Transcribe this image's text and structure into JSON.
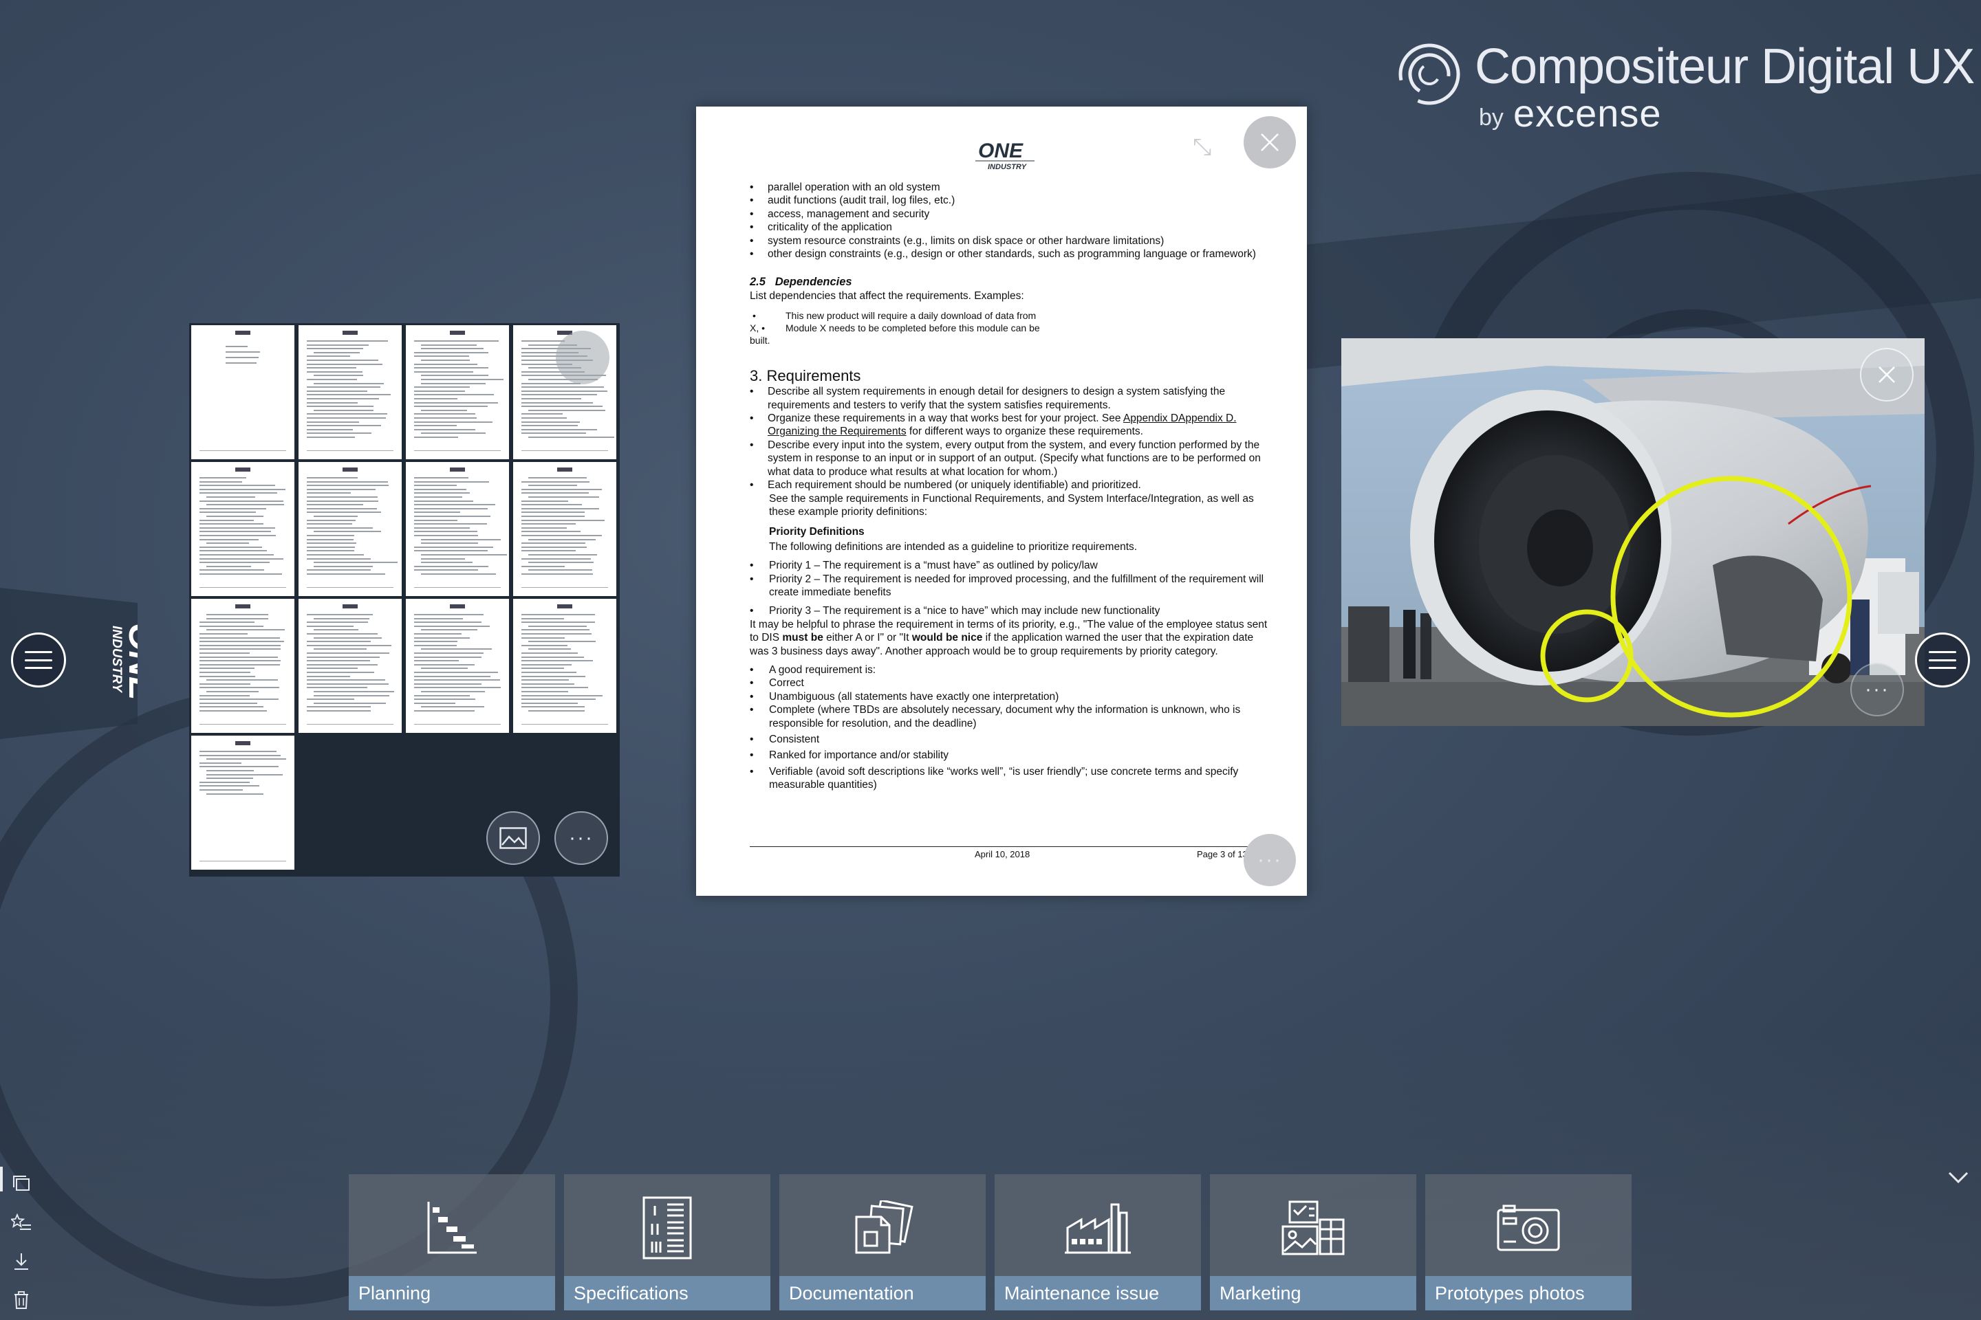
{
  "brand": {
    "title": "Compositeur Digital UX",
    "by": "by",
    "company": "excense"
  },
  "side_logo": {
    "line1": "ONE",
    "line2": "INDUSTRY"
  },
  "document": {
    "logo": {
      "line1": "ONE",
      "line2": "INDUSTRY"
    },
    "top_bullets": [
      "parallel operation with an old system",
      "audit functions (audit trail, log files, etc.)",
      "access, management and security",
      "criticality of the application",
      "system resource constraints (e.g., limits on disk space or other hardware limitations)",
      "other design constraints (e.g., design or other standards, such as programming language or framework)"
    ],
    "section_25_num": "2.5",
    "section_25_title": "Dependencies",
    "dependencies_intro": "List dependencies that affect the requirements.  Examples:",
    "dep_line1": "This new product will require a daily download of data from",
    "dep_line2_prefix": "X,  •",
    "dep_line2": "Module X needs to be completed before this module can be",
    "dep_line3": "built.",
    "section_3_title": "3. Requirements",
    "req_b1": "Describe all system requirements in enough detail for designers to design a system satisfying the requirements and testers to verify that the system satisfies requirements.",
    "req_b2_pre": "Organize these requirements in a way that works best for your project.  See ",
    "req_b2_link": "Appendix DAppendix D. Organizing the Requirements",
    "req_b2_post": "  for different ways to organize these requirements.",
    "req_b3": "Describe every input into the system, every output from the system, and every function performed by the system in response to an input or in support of an output.  (Specify what functions are to be performed on what data to produce what results at what location for whom.)",
    "req_b4": "Each requirement should be numbered (or uniquely identifiable) and prioritized.",
    "req_b4_cont": "See the sample requirements in Functional Requirements, and System Interface/Integration, as well as these example priority definitions:",
    "priority_heading": "Priority Definitions",
    "priority_intro": "The following definitions are intended as a guideline to prioritize requirements.",
    "priorities": [
      "Priority 1 – The requirement is a “must have” as outlined by policy/law",
      "Priority 2 – The requirement is needed for improved processing, and the fulfillment of the requirement will create immediate benefits",
      "Priority 3 – The requirement is a “nice to have”  which may include new functionality"
    ],
    "helpful_pre": "It may be helpful to phrase the requirement in terms of its priority, e.g., \"The value of the employee status sent to DIS ",
    "helpful_b1": "must be",
    "helpful_mid": " either A or I\" or \"It ",
    "helpful_b2": "would be nice",
    "helpful_post": " if the application warned the user that the expiration date was 3 business days away\". Another approach would be to group requirements by priority category.",
    "good_req": [
      "A good requirement is:",
      "Correct",
      "Unambiguous (all statements have exactly one interpretation)",
      "Complete (where TBDs are absolutely necessary, document why the information is unknown, who is responsible for resolution, and the deadline)",
      "Consistent",
      "Ranked for importance and/or stability",
      "Verifiable (avoid soft descriptions like “works well”, “is user friendly”; use concrete terms and specify measurable quantities)"
    ],
    "footer_date": "April 10, 2018",
    "footer_page": "Page 3 of 13"
  },
  "tiles": [
    {
      "label": "Planning",
      "icon": "gantt-chart-icon"
    },
    {
      "label": "Specifications",
      "icon": "spec-document-icon"
    },
    {
      "label": "Documentation",
      "icon": "documents-stack-icon"
    },
    {
      "label": "Maintenance issue",
      "icon": "factory-icon"
    },
    {
      "label": "Marketing",
      "icon": "marketing-board-icon"
    },
    {
      "label": "Prototypes photos",
      "icon": "camera-icon"
    }
  ],
  "left_tools": [
    "windows-icon",
    "favorites-icon",
    "download-icon",
    "trash-icon"
  ],
  "colors": {
    "tile_label": "#6e8daa",
    "annotation": "#e4ef1a",
    "background": "#3c4b60"
  }
}
